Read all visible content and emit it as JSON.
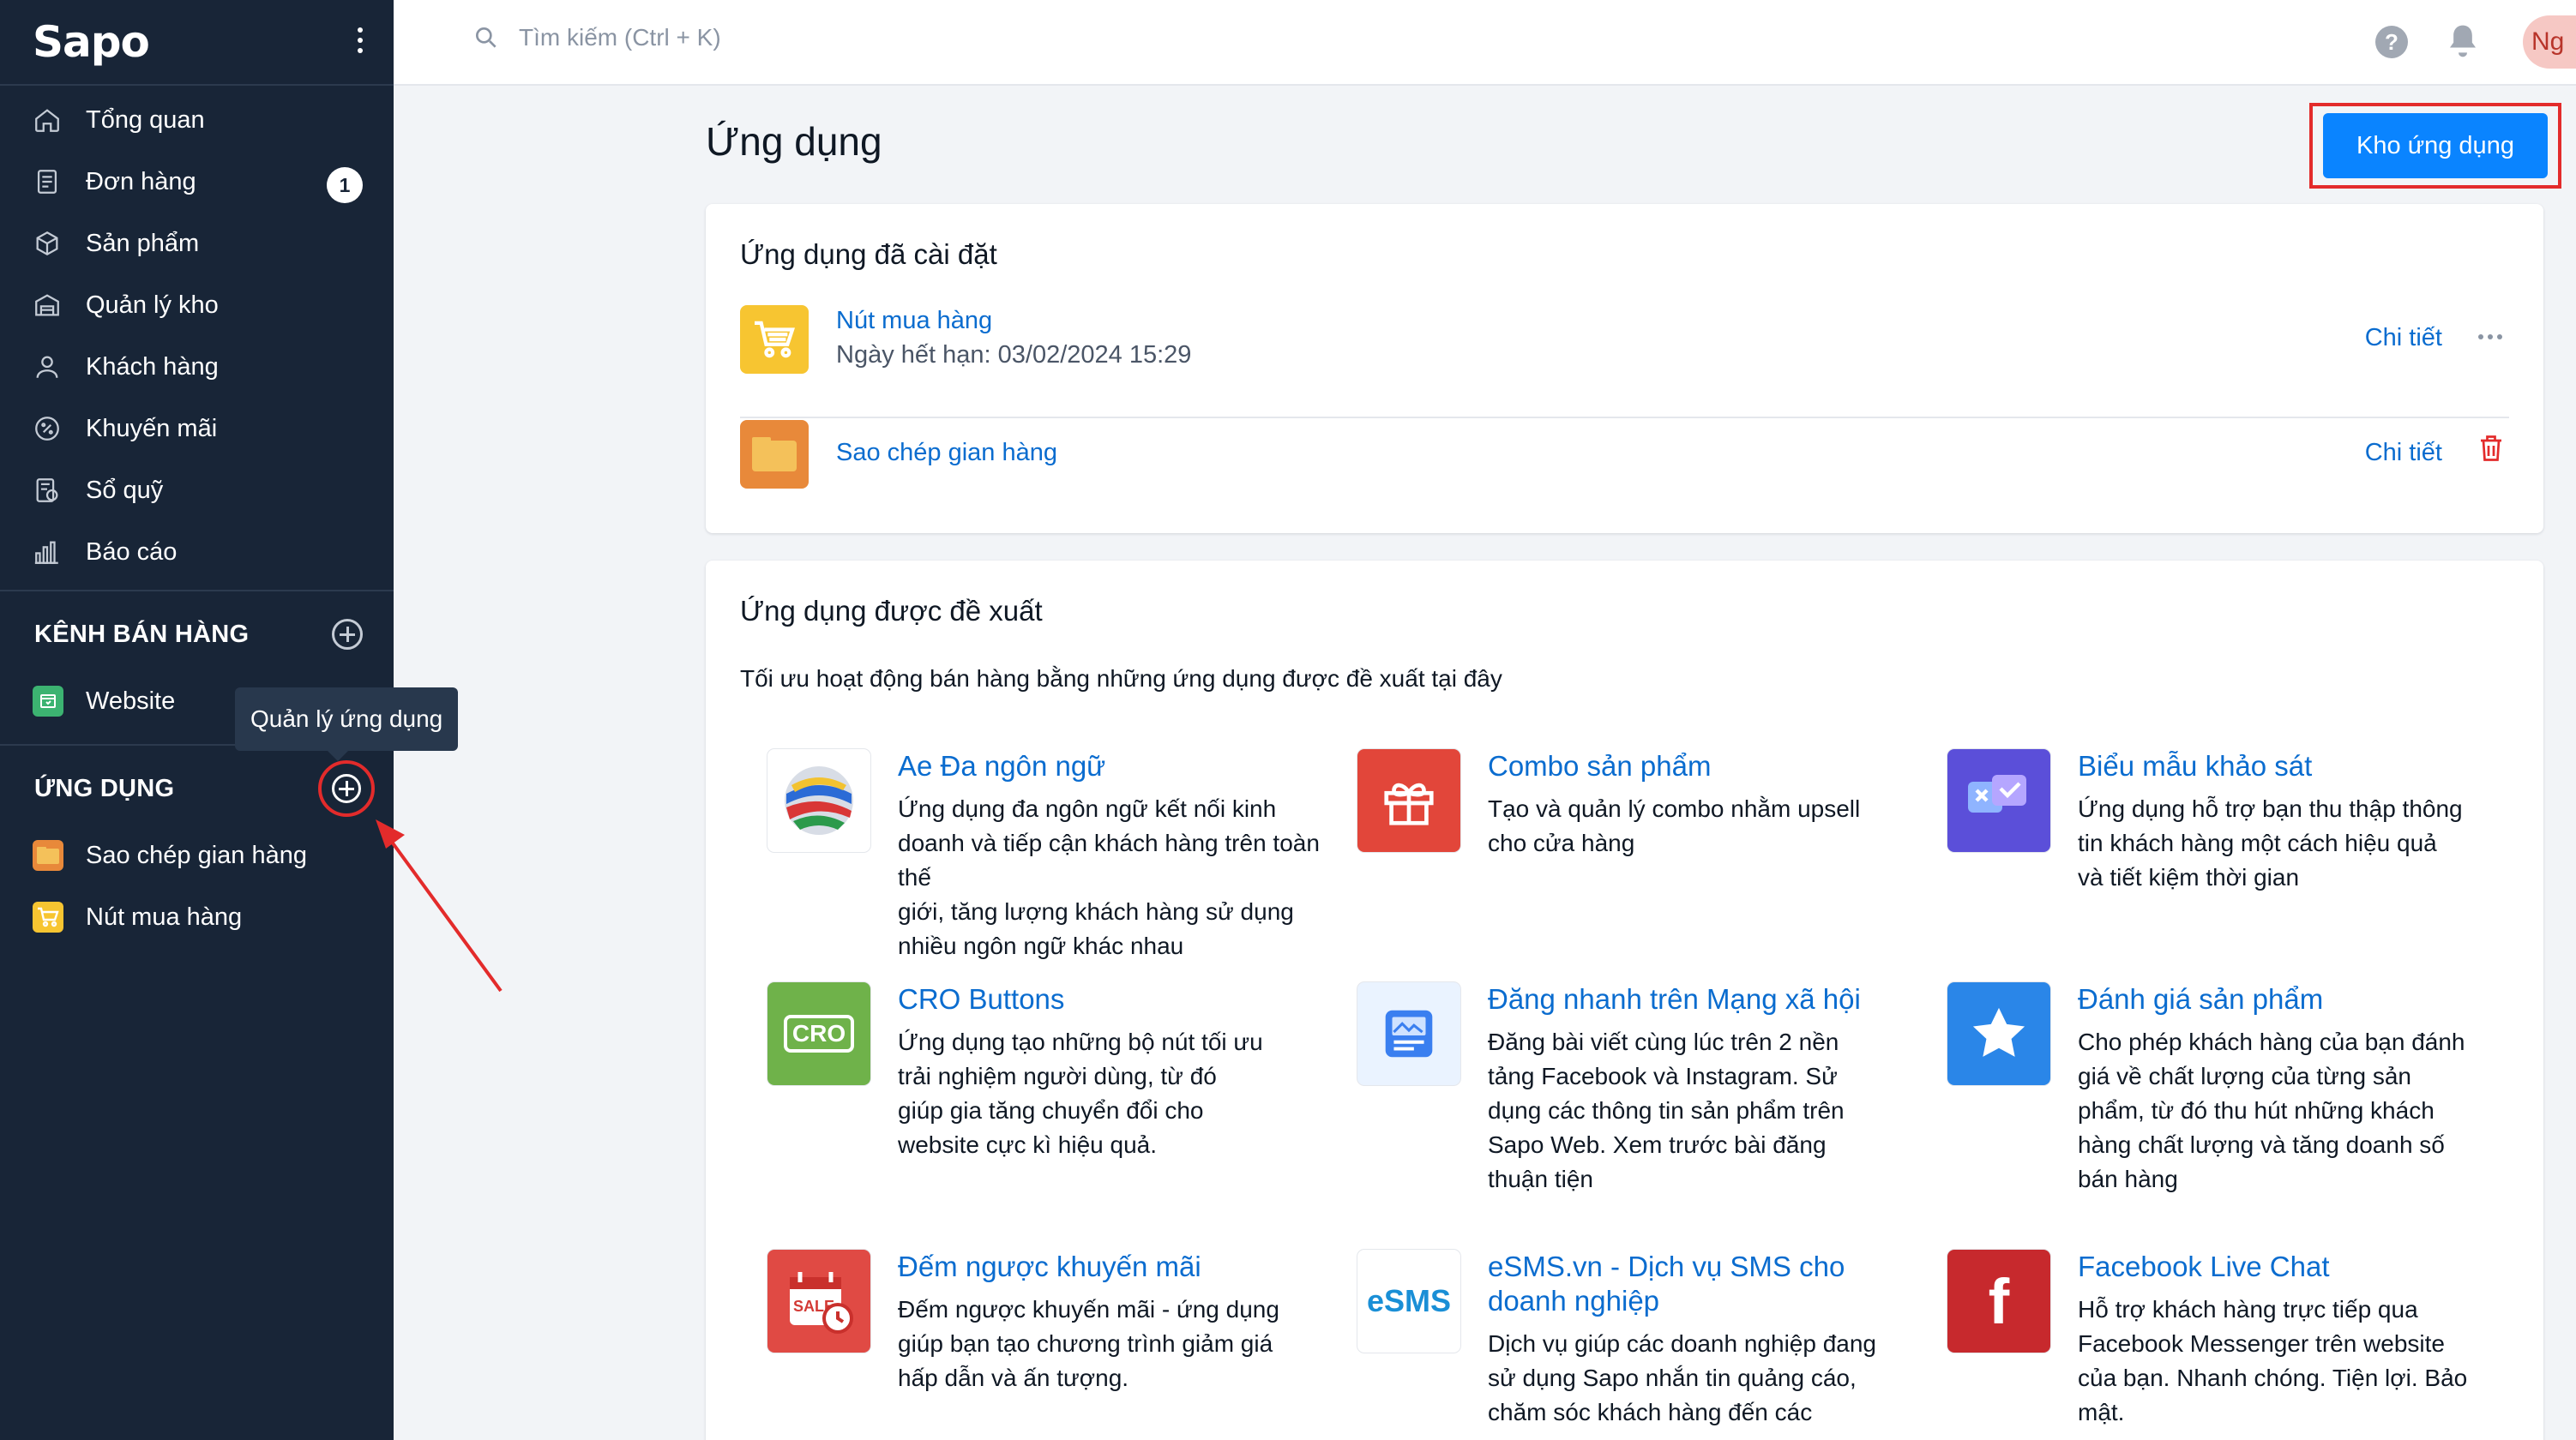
{
  "app": {
    "logo": "Sapo"
  },
  "sidebar": {
    "nav": [
      {
        "label": "Tổng quan",
        "icon": "home-icon"
      },
      {
        "label": "Đơn hàng",
        "icon": "orders-icon",
        "badge": "1"
      },
      {
        "label": "Sản phẩm",
        "icon": "box-icon"
      },
      {
        "label": "Quản lý kho",
        "icon": "warehouse-icon"
      },
      {
        "label": "Khách hàng",
        "icon": "user-icon"
      },
      {
        "label": "Khuyến mãi",
        "icon": "discount-icon"
      },
      {
        "label": "Sổ quỹ",
        "icon": "cashbook-icon"
      },
      {
        "label": "Báo cáo",
        "icon": "chart-icon"
      }
    ],
    "channels": {
      "title": "KÊNH BÁN HÀNG",
      "items": [
        {
          "label": "Website",
          "icon": "website-icon"
        }
      ]
    },
    "apps": {
      "title": "ỨNG DỤNG",
      "items": [
        {
          "label": "Sao chép gian hàng",
          "icon": "folder-icon"
        },
        {
          "label": "Nút mua hàng",
          "icon": "cart-icon"
        }
      ]
    },
    "tooltip": "Quản lý ứng dụng"
  },
  "topbar": {
    "search_placeholder": "Tìm kiếm (Ctrl + K)",
    "help": "?",
    "avatar": "Ng"
  },
  "main": {
    "title": "Ứng dụng",
    "store_button": "Kho ứng dụng",
    "installed": {
      "title": "Ứng dụng đã cài đặt",
      "items": [
        {
          "name": "Nút mua hàng",
          "expiry": "Ngày hết hạn: 03/02/2024 15:29",
          "detail": "Chi tiết"
        },
        {
          "name": "Sao chép gian hàng",
          "detail": "Chi tiết"
        }
      ]
    },
    "suggested": {
      "title": "Ứng dụng được đề xuất",
      "description": "Tối ưu hoạt động bán hàng bằng những ứng dụng được đề xuất tại đây",
      "items": [
        {
          "name": "Ae Đa ngôn ngữ",
          "desc": [
            "Ứng dụng đa ngôn ngữ kết nối kinh",
            "doanh và tiếp cận khách hàng trên toàn thế",
            "giới, tăng lượng khách hàng sử dụng",
            "nhiều ngôn ngữ khác nhau"
          ]
        },
        {
          "name": "Combo sản phẩm",
          "desc": [
            "Tạo và quản lý combo nhằm upsell",
            "cho cửa hàng"
          ]
        },
        {
          "name": "Biểu mẫu khảo sát",
          "desc": [
            "Ứng dụng hỗ trợ bạn thu thập thông",
            "tin khách hàng một cách hiệu quả",
            "và tiết kiệm thời gian"
          ]
        },
        {
          "name": "CRO Buttons",
          "icon_text": "CRO",
          "desc": [
            "Ứng dụng tạo những bộ nút tối ưu",
            "trải nghiệm người dùng, từ đó",
            "giúp gia tăng chuyển đổi cho",
            "website cực kì hiệu quả."
          ]
        },
        {
          "name": "Đăng nhanh trên Mạng xã hội",
          "desc": [
            "Đăng bài viết cùng lúc trên 2 nền",
            "tảng Facebook và Instagram. Sử",
            "dụng các thông tin sản phẩm trên",
            "Sapo Web. Xem trước bài đăng",
            "thuận tiện"
          ]
        },
        {
          "name": "Đánh giá sản phẩm",
          "desc": [
            "Cho phép khách hàng của bạn đánh",
            "giá về chất lượng của từng sản",
            "phẩm, từ đó thu hút những khách",
            "hàng chất lượng và tăng doanh số",
            "bán hàng"
          ]
        },
        {
          "name": "Đếm ngược khuyến mãi",
          "icon_text": "SALE",
          "desc": [
            "Đếm ngược khuyến mãi - ứng dụng",
            "giúp bạn tạo chương trình giảm giá",
            "hấp dẫn và ấn tượng."
          ]
        },
        {
          "name_lines": [
            "eSMS.vn - Dịch vụ SMS cho",
            "doanh nghiệp"
          ],
          "icon_text": "eSMS",
          "desc": [
            "Dịch vụ giúp các doanh nghiệp đang",
            "sử dụng Sapo nhắn tin quảng cáo,",
            "chăm sóc khách hàng đến các"
          ]
        },
        {
          "name": "Facebook Live Chat",
          "icon_text": "f",
          "desc": [
            "Hỗ trợ khách hàng trực tiếp qua",
            "Facebook Messenger trên website",
            "của bạn. Nhanh chóng. Tiện lợi. Bảo",
            "mật."
          ]
        }
      ]
    }
  },
  "colors": {
    "sidebar_bg": "#182537",
    "accent": "#0a84ff",
    "link": "#0a6ccf",
    "highlight": "#e32b2b"
  }
}
